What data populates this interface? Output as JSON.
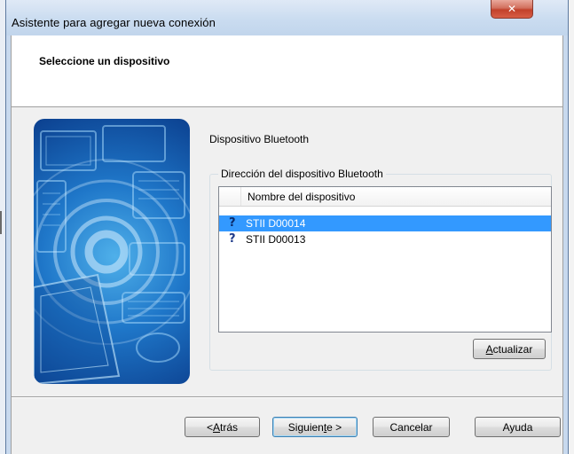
{
  "window": {
    "title": "Asistente para agregar nueva conexión",
    "close_glyph": "✕"
  },
  "header": {
    "title": "Seleccione un dispositivo"
  },
  "hero": {
    "icon": "bluetooth-devices-illustration"
  },
  "device_type_label": "Dispositivo Bluetooth",
  "address_group": {
    "legend": "Dirección del dispositivo Bluetooth",
    "column_header": "Nombre del dispositivo",
    "devices": [
      {
        "name": "STII D00014",
        "icon": "unknown-device-icon",
        "selected": true
      },
      {
        "name": "STII D00013",
        "icon": "unknown-device-icon",
        "selected": false
      }
    ],
    "refresh_button": {
      "prefix": "",
      "accel": "A",
      "rest": "ctualizar"
    }
  },
  "buttons": {
    "back": {
      "prefix": "< ",
      "accel": "A",
      "rest": "trás"
    },
    "next": {
      "prefix": "Siguien",
      "accel": "t",
      "rest": "e >"
    },
    "cancel": "Cancelar",
    "help": "Ayuda"
  },
  "colors": {
    "selection": "#3399ff",
    "hero_blue": "#1f77c9",
    "close_red": "#c2412b"
  }
}
